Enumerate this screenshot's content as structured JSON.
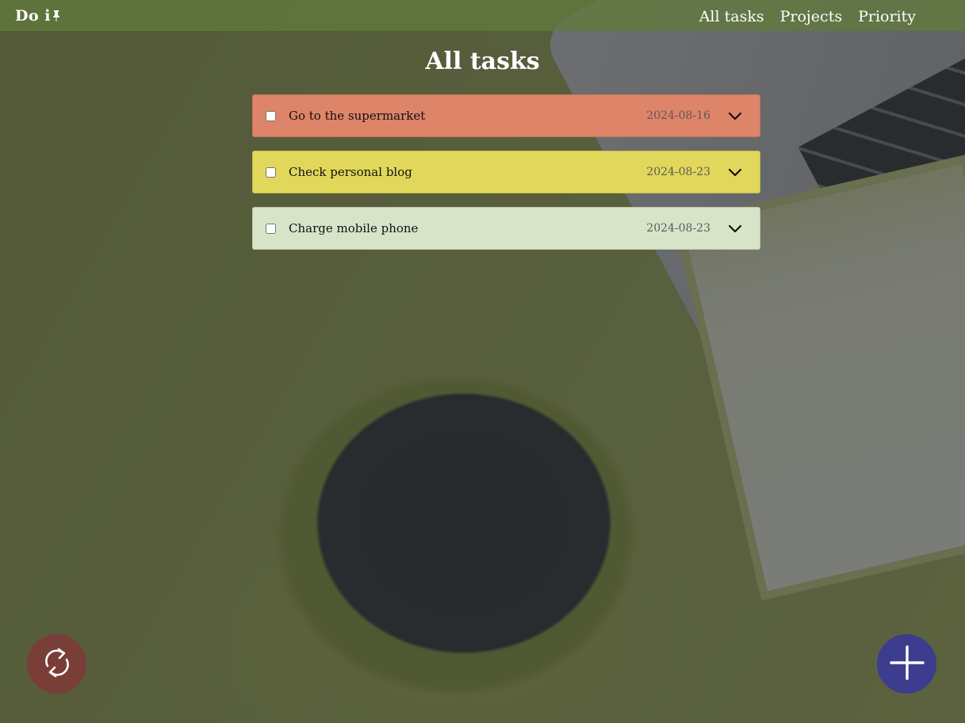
{
  "header": {
    "logo": "Do i",
    "logo_icon": "pushpin-icon",
    "nav": [
      {
        "label": "All tasks"
      },
      {
        "label": "Projects"
      },
      {
        "label": "Priority"
      }
    ]
  },
  "page_title": "All tasks",
  "tasks": [
    {
      "name": "Go to the supermarket",
      "date": "2024-08-16",
      "checked": false,
      "color": "#de8468"
    },
    {
      "name": "Check personal blog",
      "date": "2024-08-23",
      "checked": false,
      "color": "#e1d75a"
    },
    {
      "name": "Charge mobile phone",
      "date": "2024-08-23",
      "checked": false,
      "color": "#d7e4c8"
    }
  ],
  "buttons": {
    "refresh_icon": "refresh-icon",
    "refresh_color": "#7a3e38",
    "add_icon": "plus-icon",
    "add_color": "#3d3d8f"
  }
}
